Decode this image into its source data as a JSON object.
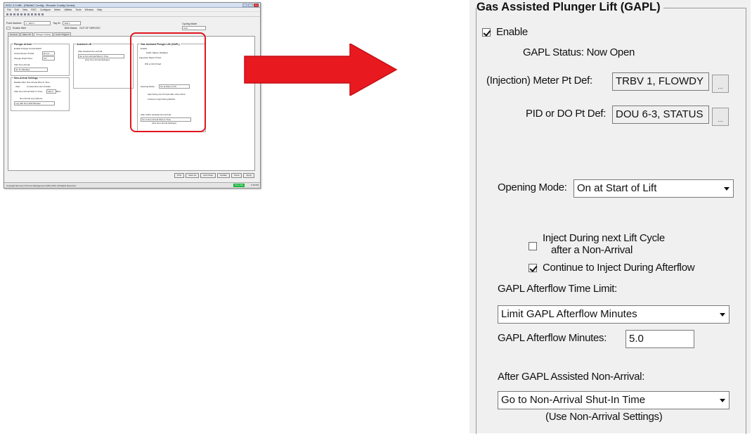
{
  "thumbnail": {
    "window_title": "ROC 2.0 MB - [PAMAC Config - Remote Config Center]",
    "menu": [
      "File",
      "Edit",
      "View",
      "ROC",
      "Configure",
      "Meter",
      "Utilities",
      "Tools",
      "Window",
      "Help"
    ],
    "point_number_label": "Point Number:",
    "point_number_value": "1 - Well 1",
    "tag_label": "Tag ID:",
    "tag_value": "Well 1",
    "enable_well_label": "Enable Well",
    "well_status_label": "Well Status:",
    "well_status_value": "OUT OF SERVICE",
    "cycling_mode_label": "Cycling Mode",
    "cycling_mode_value": "Auto",
    "tabs": [
      "General",
      "Sales Lift",
      "Plunger Cycling",
      "Cycle Triggers"
    ],
    "plunger_arrival": {
      "title": "Plunger Arrival",
      "enable_label": "Enable Plunger Arrival Switch",
      "arrival_sensor_label": "Arrival Sensor Pt Def:",
      "arrival_sensor_value": "DI 4-1",
      "plunger_dwell_label": "Plunger Dwell Time:",
      "plunger_dwell_value": "0.0",
      "after_arrival_label": "After Non-Arrival:",
      "after_arrival_value": "Go To Afterflow"
    },
    "non_arrival": {
      "title": "Non-Arrival Settings",
      "disable_label": "Disable After Non-Arrival Shut-In Time",
      "after_label": "After",
      "consecutive_label": "Consecutive Non-Arrivals",
      "shutin_label": "After Non-Arrival Shut-In Time:",
      "shutin_value": "120.0",
      "shutin_unit": "Mins",
      "log_label": "Non-Arrival Log Options:",
      "log_value": "Log with Non-Vital Minutes"
    },
    "assisted_lift": {
      "title": "Assisted Lift",
      "after_label": "After Assisted Non-Arrival:",
      "after_value": "Go to Non-Arrival Shut-In Time",
      "note": "(Use Non-Arrival Settings)"
    },
    "mini_gapl": {
      "title": "Gas Assisted Plunger Lift (GAPL)",
      "enable": "Enable",
      "status": "GAPL Status: Disabled",
      "meter_label": "(Injection) Meter Pt Def:",
      "pid_label": "PID or DO Pt Def:",
      "opening_label": "Opening Mode:",
      "opening_value": "On at Start of Lift",
      "inject_label": "Inject During next Lift Cycle after a Non-Arrival",
      "continue_label": "Continue to Inject During Afterflow",
      "after_label": "After GAPL Assisted Non-Arrival:",
      "after_value": "Go to Non-Arrival Shut-In Time",
      "note": "(Use Non-Arrival Settings)"
    },
    "buttons": [
      "Print",
      "Save As",
      "Auto Scan",
      "Update",
      "Close",
      "Apply"
    ],
    "status_text": "Copyright Emerson Process Management 2010-2014. All Rights Reserved.",
    "online": "ON-LINE",
    "time": "1:33 PM"
  },
  "gapl": {
    "title": "Gas Assisted Plunger Lift (GAPL)",
    "enable_label": "Enable",
    "enable_checked": true,
    "status_text": "GAPL Status: Now Open",
    "meter_label": "(Injection) Meter Pt Def:",
    "meter_value": "TRBV 1, FLOWDY",
    "pid_label": "PID or DO Pt Def:",
    "pid_value": "DOU 6-3, STATUS",
    "browse_button": "...",
    "opening_label": "Opening Mode:",
    "opening_value": "On at Start of Lift",
    "inject_next_line1": "Inject During next Lift Cycle",
    "inject_next_line2": "after a Non-Arrival",
    "inject_next_checked": false,
    "continue_label": "Continue to Inject During Afterflow",
    "continue_checked": true,
    "afterflow_limit_label": "GAPL Afterflow Time Limit:",
    "afterflow_limit_value": "Limit GAPL Afterflow Minutes",
    "afterflow_minutes_label": "GAPL Afterflow Minutes:",
    "afterflow_minutes_value": "5.0",
    "after_nonarrival_label": "After GAPL Assisted Non-Arrival:",
    "after_nonarrival_value": "Go to Non-Arrival Shut-In Time",
    "use_settings_note": "(Use Non-Arrival Settings)"
  },
  "colors": {
    "highlight": "#e0161f",
    "arrow": "#e8191f",
    "online": "#19b53a"
  }
}
